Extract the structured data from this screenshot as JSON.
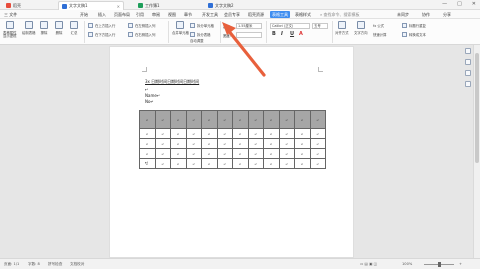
{
  "titlebar": {
    "tabs": [
      {
        "label": "稻壳",
        "color": "#e74c3c"
      },
      {
        "label": "文字文稿1",
        "color": "#2f6fd6"
      },
      {
        "label": "工作簿1",
        "color": "#1e9e5a"
      },
      {
        "label": "文字文稿2",
        "color": "#2f6fd6"
      }
    ],
    "window_buttons": [
      "—",
      "□",
      "✕"
    ]
  },
  "menubar": {
    "items": [
      "三 文件",
      "开始",
      "插入",
      "页面布局",
      "引用",
      "审阅",
      "视图",
      "章节",
      "开发工具",
      "会员专享",
      "稻壳资源",
      "表格工具",
      "表格样式"
    ],
    "active_index": 11,
    "search": "查找命令、搜索模板",
    "right_items": [
      "未同步",
      "协作",
      "分享"
    ]
  },
  "ribbon": {
    "tools_large": [
      "表格属性",
      "显示虚框",
      "绘制表格",
      "擦除",
      "删除",
      "汇总",
      "在上方插入行",
      "在下方插入行",
      "在左侧插入列",
      "在右侧插入列",
      "合并单元格",
      "拆分单元格",
      "拆分表格",
      "自动调整"
    ],
    "height_label": "高度:",
    "height_value": "1.55厘米",
    "width_label": "宽度:",
    "font_name": "Calibri (正文)",
    "font_size": "五号",
    "format_buttons": [
      "B",
      "I",
      "U",
      "A"
    ],
    "align_label": "对齐方式",
    "text_dir": "文字方向",
    "fx_label": "fx 公式",
    "sort_label": "快速计算",
    "repeat_header": "标题行重复",
    "convert_text": "转换成文本"
  },
  "document": {
    "heading": "3x 日期时间日期时间日期时间",
    "lines": [
      "↵",
      "Name↵",
      "No↵"
    ],
    "table": {
      "header": [
        "↵",
        "↵",
        "↵",
        "↵",
        "↵",
        "↵",
        "↵",
        "↵",
        "↵",
        "↵",
        "↵",
        "↵"
      ],
      "rows": [
        [
          "↵",
          "↵",
          "↵",
          "↵",
          "↵",
          "↵",
          "↵",
          "↵",
          "↵",
          "↵",
          "↵",
          "↵"
        ],
        [
          "↵",
          "↵",
          "↵",
          "↵",
          "↵",
          "↵",
          "↵",
          "↵",
          "↵",
          "↵",
          "↵",
          "↵"
        ],
        [
          "↵",
          "↵",
          "↵",
          "↵",
          "↵",
          "↵",
          "↵",
          "↵",
          "↵",
          "↵",
          "↵",
          "↵"
        ],
        [
          "↵",
          "↵",
          "↵",
          "↵",
          "↵",
          "↵",
          "↵",
          "↵",
          "↵",
          "↵",
          "↵",
          "↵"
        ]
      ]
    },
    "after_table": "↵",
    "arrow_color": "#e8603c"
  },
  "statusbar": {
    "page": "页面: 1/1",
    "words": "字数: 8",
    "spell": "拼写检查",
    "doc_check": "文档校对",
    "zoom": "100%"
  }
}
